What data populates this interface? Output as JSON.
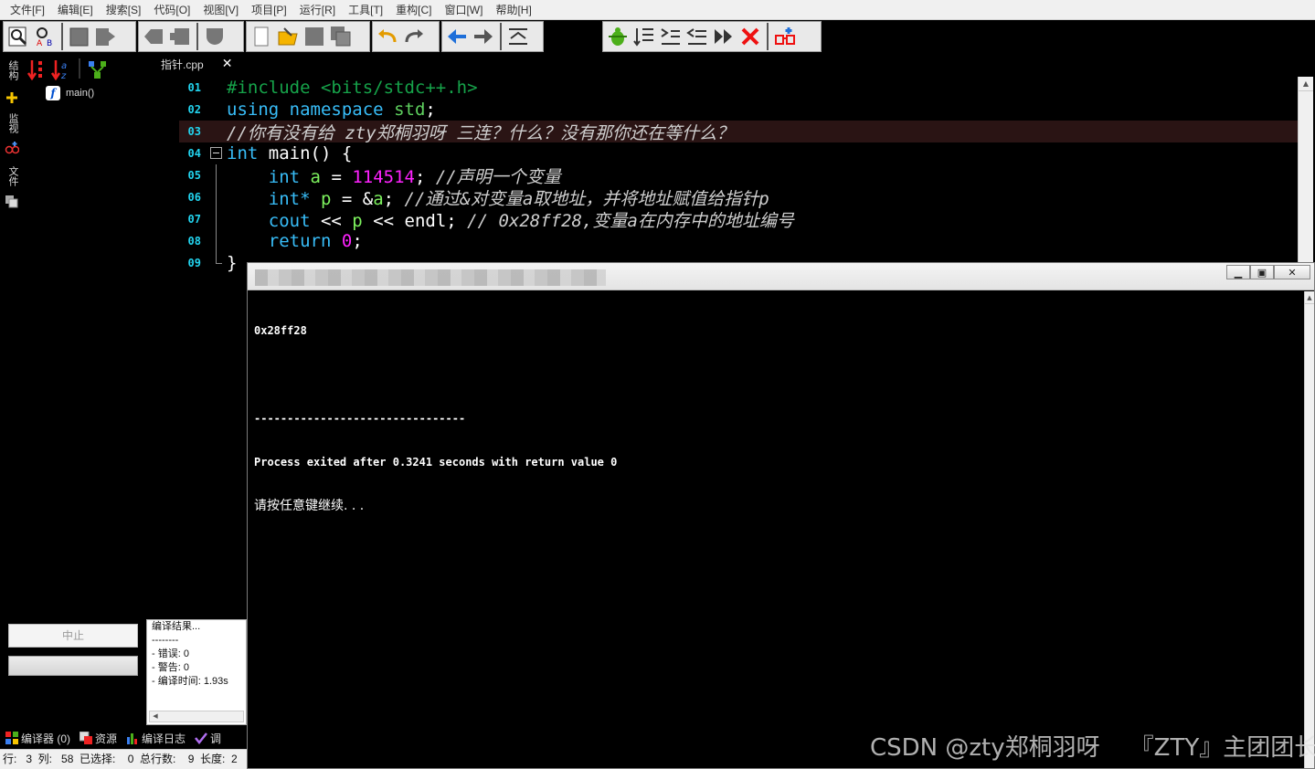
{
  "menu": [
    "文件[F]",
    "编辑[E]",
    "搜索[S]",
    "代码[O]",
    "视图[V]",
    "项目[P]",
    "运行[R]",
    "工具[T]",
    "重构[C]",
    "窗口[W]",
    "帮助[H]"
  ],
  "left_tabs": {
    "structure": "结构",
    "watch": "监视",
    "files": "文件"
  },
  "tree": {
    "func_label": "main()"
  },
  "file_tab": {
    "name": "指针.cpp"
  },
  "editor": {
    "line_numbers": [
      "01",
      "02",
      "03",
      "04",
      "05",
      "06",
      "07",
      "08",
      "09"
    ],
    "lines": [
      {
        "parts": [
          {
            "t": "#include <bits/stdc++.h>",
            "c": "pre"
          }
        ]
      },
      {
        "parts": [
          {
            "t": "using",
            "c": "kw"
          },
          {
            "t": " ",
            "c": "ns"
          },
          {
            "t": "namespace",
            "c": "kw"
          },
          {
            "t": " ",
            "c": "ns"
          },
          {
            "t": "std",
            "c": "std"
          },
          {
            "t": ";",
            "c": "ns"
          }
        ]
      },
      {
        "parts": [
          {
            "t": "//你有没有给 zty郑桐羽呀 三连？什么？没有那你还在等什么？",
            "c": "com"
          }
        ]
      },
      {
        "parts": [
          {
            "t": "int",
            "c": "kw"
          },
          {
            "t": " main() {",
            "c": "ns"
          }
        ]
      },
      {
        "parts": [
          {
            "t": "    ",
            "c": "ns"
          },
          {
            "t": "int",
            "c": "kw"
          },
          {
            "t": " ",
            "c": "ns"
          },
          {
            "t": "a",
            "c": "var"
          },
          {
            "t": " = ",
            "c": "ns"
          },
          {
            "t": "114514",
            "c": "num"
          },
          {
            "t": "; ",
            "c": "ns"
          },
          {
            "t": "//声明一个变量",
            "c": "com"
          }
        ]
      },
      {
        "parts": [
          {
            "t": "    ",
            "c": "ns"
          },
          {
            "t": "int*",
            "c": "kw"
          },
          {
            "t": " ",
            "c": "ns"
          },
          {
            "t": "p",
            "c": "var"
          },
          {
            "t": " = &",
            "c": "ns"
          },
          {
            "t": "a",
            "c": "var"
          },
          {
            "t": "; ",
            "c": "ns"
          },
          {
            "t": "//通过&对变量a取地址，并将地址赋值给指针p",
            "c": "com"
          }
        ]
      },
      {
        "parts": [
          {
            "t": "    ",
            "c": "ns"
          },
          {
            "t": "cout",
            "c": "kw"
          },
          {
            "t": " << ",
            "c": "ns"
          },
          {
            "t": "p",
            "c": "var"
          },
          {
            "t": " << endl; ",
            "c": "ns"
          },
          {
            "t": "// 0x28ff28,变量a在内存中的地址编号",
            "c": "com"
          }
        ]
      },
      {
        "parts": [
          {
            "t": "    ",
            "c": "ns"
          },
          {
            "t": "return",
            "c": "kw"
          },
          {
            "t": " ",
            "c": "ns"
          },
          {
            "t": "0",
            "c": "num"
          },
          {
            "t": ";",
            "c": "ns"
          }
        ]
      },
      {
        "parts": [
          {
            "t": "}",
            "c": "ns"
          }
        ]
      }
    ]
  },
  "console": {
    "output": "0x28ff28",
    "separator": "--------------------------------",
    "process_line": "Process exited after 0.3241 seconds with return value 0",
    "press_key": "请按任意键继续. . ."
  },
  "bottom": {
    "stop_label": "中止",
    "results": [
      "编译结果...",
      "--------",
      "- 错误: 0",
      "- 警告: 0",
      "- 编译时间: 1.93s"
    ],
    "tabs": [
      "编译器 (0)",
      "资源",
      "编译日志",
      "调"
    ],
    "status": "行:   3  列:   58  已选择:    0  总行数:    9  长度:  2"
  },
  "watermark": "CSDN @zty郑桐羽呀    『ZTY』主团团长",
  "colors": {
    "keyword": "#38bdf8",
    "preprocessor": "#16a34a",
    "number": "#ff22ff",
    "variable": "#7df25e",
    "line_number": "#22d3ee"
  }
}
